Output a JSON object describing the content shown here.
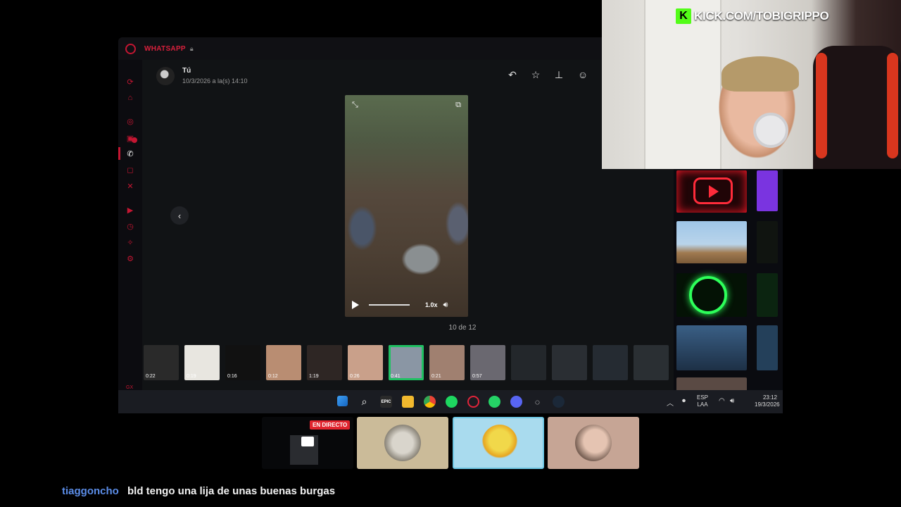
{
  "browser": {
    "app_title": "WHATSAPP",
    "colors": {
      "accent": "#c41632",
      "whatsapp_green": "#21c063"
    }
  },
  "viewer": {
    "sender_name": "Tú",
    "timestamp": "10/3/2026 a la(s) 14:10",
    "tools": [
      "reply-icon",
      "star-icon",
      "pin-icon",
      "emoji-icon"
    ],
    "video": {
      "speed": "1.0x",
      "progress": 0.0
    },
    "counter": "10 de 12",
    "thumbnails": [
      {
        "duration": "0:22",
        "selected": false,
        "dim": false
      },
      {
        "duration": "0:19",
        "selected": false,
        "dim": false
      },
      {
        "duration": "0:16",
        "selected": false,
        "dim": false
      },
      {
        "duration": "0:12",
        "selected": false,
        "dim": false
      },
      {
        "duration": "1:19",
        "selected": false,
        "dim": false
      },
      {
        "duration": "0:26",
        "selected": false,
        "dim": false
      },
      {
        "duration": "0:41",
        "selected": true,
        "dim": false
      },
      {
        "duration": "0:21",
        "selected": false,
        "dim": false
      },
      {
        "duration": "0:57",
        "selected": false,
        "dim": false
      },
      {
        "duration": "",
        "selected": false,
        "dim": true
      },
      {
        "duration": "",
        "selected": false,
        "dim": true
      },
      {
        "duration": "",
        "selected": false,
        "dim": true
      },
      {
        "duration": "",
        "selected": false,
        "dim": true
      }
    ]
  },
  "sidebar_extra": "GX",
  "taskbar": {
    "lang_line1": "ESP",
    "lang_line2": "LAA",
    "time": "23:12",
    "date": "19/3/2026",
    "epic_label": "EPIC"
  },
  "stream": {
    "banner_logo": "K",
    "banner_url": "KICK.COM/TOBIGRIPPO",
    "live_badge": "EN DIRECTO"
  },
  "chat": {
    "username": "tiaggoncho",
    "message": "bld tengo una lija de unas buenas burgas"
  }
}
